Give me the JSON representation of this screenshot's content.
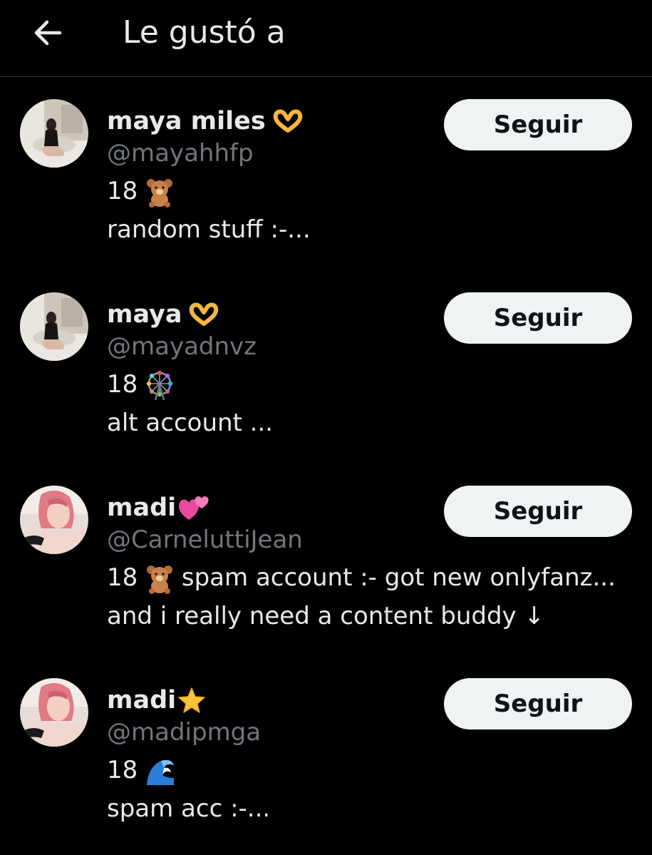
{
  "header": {
    "back_icon": "arrow-left-icon",
    "title": "Le gustó a"
  },
  "users": [
    {
      "display_name": "maya miles",
      "name_emoji": "heart-hands-emoji",
      "handle": "@mayahhfp",
      "bio_line1": "18",
      "bio_line1_emoji": "teddy-bear-emoji",
      "bio_line1_rest": "",
      "bio_line2": "random stuff :-...",
      "follow_label": "Seguir"
    },
    {
      "display_name": "maya",
      "name_emoji": "heart-hands-emoji",
      "handle": "@mayadnvz",
      "bio_line1": "18",
      "bio_line1_emoji": "ferris-wheel-emoji",
      "bio_line1_rest": "",
      "bio_line2": "alt account ...",
      "follow_label": "Seguir"
    },
    {
      "display_name": "madi",
      "name_emoji": "two-hearts-emoji",
      "handle": "@CarneluttiJean",
      "bio_line1": "18",
      "bio_line1_emoji": "teddy-bear-emoji",
      "bio_line1_rest": "spam account :- got new onlyfanz...",
      "bio_line2": "and i really need a content buddy ↓",
      "follow_label": "Seguir"
    },
    {
      "display_name": "madi",
      "name_emoji": "star-emoji",
      "handle": "@madipmga",
      "bio_line1": "18",
      "bio_line1_emoji": "wave-emoji",
      "bio_line1_rest": "",
      "bio_line2": "spam acc :-...",
      "follow_label": "Seguir"
    }
  ],
  "colors": {
    "background": "#000000",
    "primary_text": "#e7e9ea",
    "secondary_text": "#71767b",
    "divider": "#2f3336",
    "button_bg": "#eff3f4",
    "button_text": "#0f1419"
  }
}
